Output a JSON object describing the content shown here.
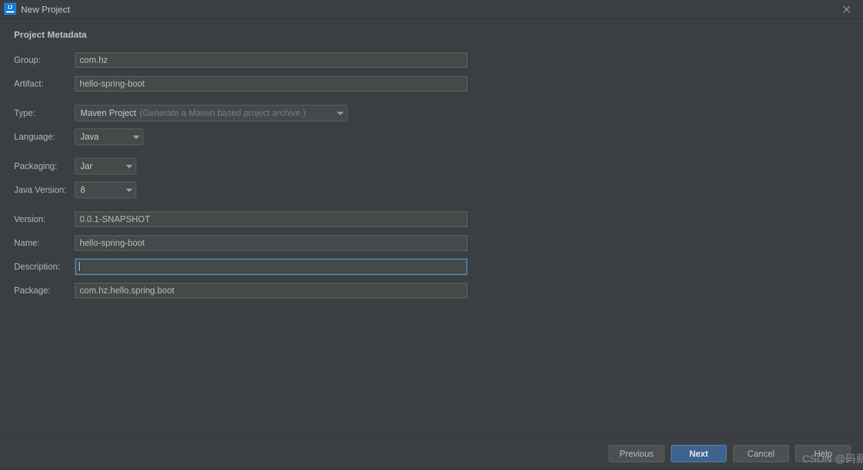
{
  "window": {
    "title": "New Project",
    "app_icon": "intellij-idea-icon",
    "icon_letters": "IJ",
    "close_icon": "close-icon"
  },
  "section": {
    "heading": "Project Metadata"
  },
  "fields": {
    "group": {
      "label": "Group:",
      "value": "com.hz"
    },
    "artifact": {
      "label": "Artifact:",
      "value": "hello-spring-boot"
    },
    "type": {
      "label": "Type:",
      "value": "Maven Project",
      "hint": "(Generate a Maven based project archive.)",
      "chevron_icon": "chevron-down-icon"
    },
    "language": {
      "label": "Language:",
      "value": "Java",
      "chevron_icon": "chevron-down-icon"
    },
    "packaging": {
      "label": "Packaging:",
      "value": "Jar",
      "chevron_icon": "chevron-down-icon"
    },
    "java_version": {
      "label": "Java Version:",
      "value": "8",
      "chevron_icon": "chevron-down-icon"
    },
    "version": {
      "label": "Version:",
      "value": "0.0.1-SNAPSHOT"
    },
    "name": {
      "label": "Name:",
      "value": "hello-spring-boot"
    },
    "description": {
      "label": "Description:",
      "value": "",
      "focused": true
    },
    "package": {
      "label": "Package:",
      "value": "com.hz.hello.spring.boot"
    }
  },
  "footer": {
    "previous_label": "Previous",
    "next_label": "Next",
    "cancel_label": "Cancel",
    "help_label": "Help"
  },
  "watermark": {
    "text": "CSDN @码薪"
  },
  "colors": {
    "background": "#3c3f41",
    "input_background": "#45494a",
    "focus_border": "#4b7ea8",
    "primary_button": "#3f638f",
    "text": "#bbbbbb"
  }
}
